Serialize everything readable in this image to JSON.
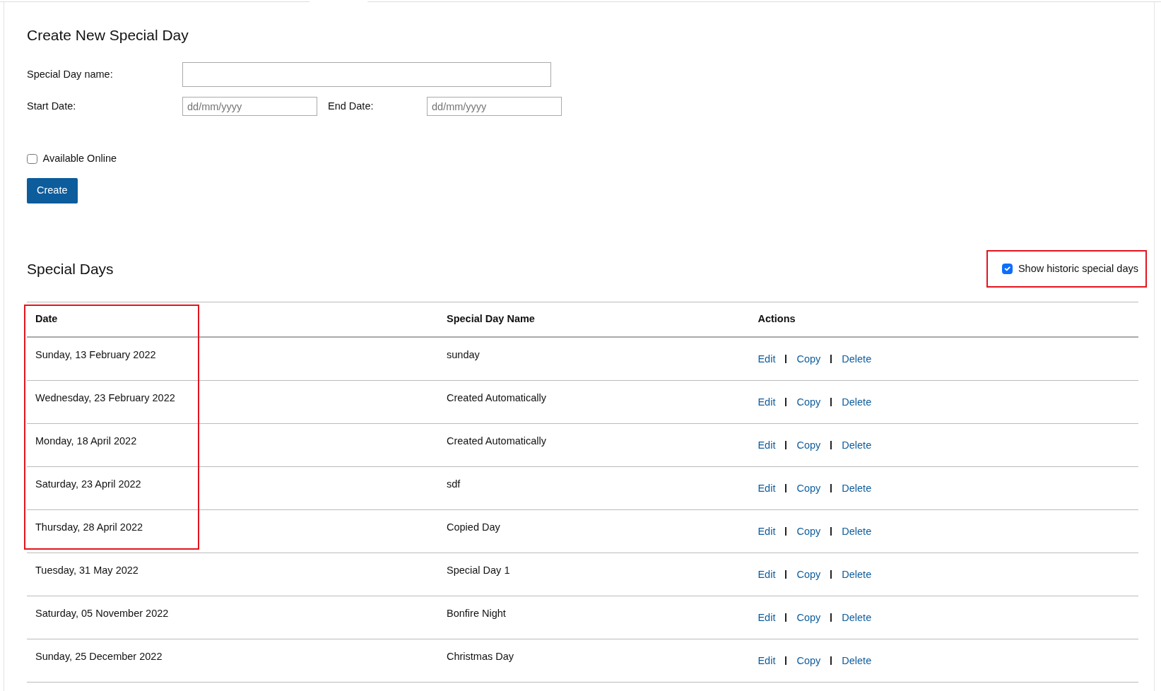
{
  "create_form": {
    "title": "Create New Special Day",
    "name_label": "Special Day name:",
    "start_label": "Start Date:",
    "start_placeholder": "dd/mm/yyyy",
    "end_label": "End Date:",
    "end_placeholder": "dd/mm/yyyy",
    "available_online": {
      "label": "Available Online",
      "checked": false
    },
    "create_button": "Create"
  },
  "list": {
    "title": "Special Days",
    "show_historic": {
      "label": "Show historic special days",
      "checked": true,
      "highlighted": true
    },
    "columns": [
      "Date",
      "Special Day Name",
      "Actions"
    ],
    "rows": [
      {
        "date": "Sunday, 13 February 2022",
        "name": "sunday",
        "actions": [
          "Edit",
          "Copy",
          "Delete"
        ],
        "date_highlighted": true
      },
      {
        "date": "Wednesday, 23 February 2022",
        "name": "Created Automatically",
        "actions": [
          "Edit",
          "Copy",
          "Delete"
        ],
        "date_highlighted": true
      },
      {
        "date": "Monday, 18 April 2022",
        "name": "Created Automatically",
        "actions": [
          "Edit",
          "Copy",
          "Delete"
        ],
        "date_highlighted": true
      },
      {
        "date": "Saturday, 23 April 2022",
        "name": "sdf",
        "actions": [
          "Edit",
          "Copy",
          "Delete"
        ],
        "date_highlighted": true
      },
      {
        "date": "Thursday, 28 April 2022",
        "name": "Copied Day",
        "actions": [
          "Edit",
          "Copy",
          "Delete"
        ],
        "date_highlighted": true
      },
      {
        "date": "Tuesday, 31 May 2022",
        "name": "Special Day 1",
        "actions": [
          "Edit",
          "Copy",
          "Delete"
        ],
        "date_highlighted": false
      },
      {
        "date": "Saturday, 05 November 2022",
        "name": "Bonfire Night",
        "actions": [
          "Edit",
          "Copy",
          "Delete"
        ],
        "date_highlighted": false
      },
      {
        "date": "Sunday, 25 December 2022",
        "name": "Christmas Day",
        "actions": [
          "Edit",
          "Copy",
          "Delete"
        ],
        "date_highlighted": false
      }
    ]
  }
}
